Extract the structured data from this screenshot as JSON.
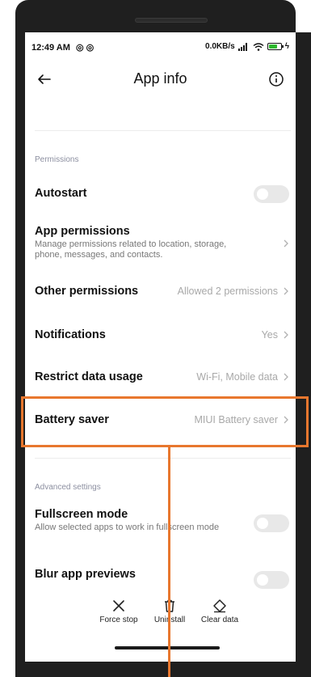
{
  "status_bar": {
    "time": "12:49 AM",
    "network_speed": "0.0KB/s",
    "battery_level": 0.75
  },
  "header": {
    "title": "App info"
  },
  "sections": {
    "permissions_label": "Permissions",
    "advanced_label": "Advanced settings"
  },
  "rows": {
    "autostart": {
      "title": "Autostart",
      "enabled": false
    },
    "app_permissions": {
      "title": "App permissions",
      "subtitle": "Manage permissions related to location, storage, phone, messages, and contacts."
    },
    "other_permissions": {
      "title": "Other permissions",
      "value": "Allowed 2 permissions"
    },
    "notifications": {
      "title": "Notifications",
      "value": "Yes"
    },
    "restrict_data": {
      "title": "Restrict data usage",
      "value": "Wi-Fi, Mobile data"
    },
    "battery_saver": {
      "title": "Battery saver",
      "value": "MIUI Battery saver"
    },
    "fullscreen_mode": {
      "title": "Fullscreen mode",
      "subtitle": "Allow selected apps to work in fullscreen mode",
      "enabled": false
    },
    "blur_previews": {
      "title": "Blur app previews",
      "enabled": false
    }
  },
  "actions": {
    "force_stop": "Force stop",
    "uninstall": "Uninstall",
    "clear_data": "Clear data"
  },
  "colors": {
    "highlight": "#e8772e",
    "section_label": "#8c8fa0",
    "battery_fill": "#2eb82e"
  },
  "icons": {
    "back": "arrow-left-icon",
    "info": "info-icon",
    "chevron": "chevron-right-icon",
    "force_stop": "close-icon",
    "uninstall": "trash-icon",
    "clear_data": "eraser-icon"
  }
}
